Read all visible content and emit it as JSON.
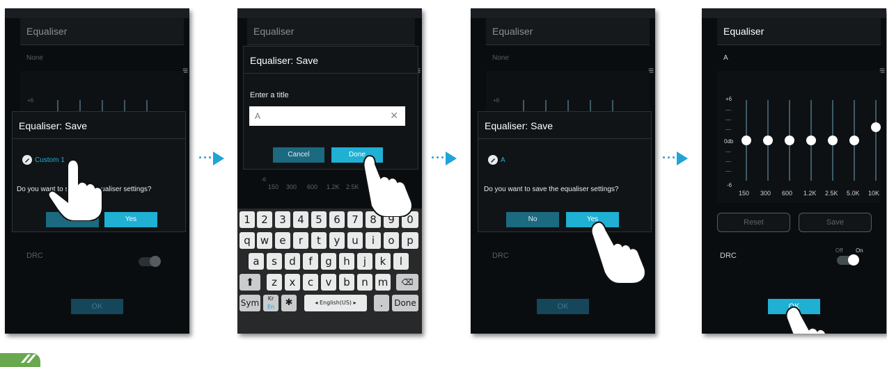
{
  "colors": {
    "accent": "#1fb0d4",
    "dark_button": "#1c6a80",
    "background": "#0a0d10",
    "arrow": "#1fa4d8"
  },
  "screen1": {
    "header_title": "Equaliser",
    "preset": "None",
    "db_top": "+6",
    "dialog": {
      "title": "Equaliser: Save",
      "preset_name": "Custom 1",
      "question": "Do you want to save the equaliser settings?",
      "no": "No",
      "yes": "Yes"
    },
    "drc": "DRC",
    "ok": "OK"
  },
  "screen2": {
    "header_title": "Equaliser",
    "dialog": {
      "title": "Equaliser: Save",
      "prompt": "Enter a title",
      "input_value": "A",
      "clear_icon": "close-icon",
      "cancel": "Cancel",
      "done": "Done"
    },
    "db_bottom": "-6",
    "freqs": [
      "150",
      "300",
      "600",
      "1.2K",
      "2.5K"
    ],
    "keyboard": {
      "row1": [
        "1",
        "2",
        "3",
        "4",
        "5",
        "6",
        "7",
        "8",
        "9",
        "0"
      ],
      "row2": [
        "q",
        "w",
        "e",
        "r",
        "t",
        "y",
        "u",
        "i",
        "o",
        "p"
      ],
      "row3": [
        "a",
        "s",
        "d",
        "f",
        "g",
        "h",
        "j",
        "k",
        "l"
      ],
      "row4": [
        "z",
        "x",
        "c",
        "v",
        "b",
        "n",
        "m"
      ],
      "sym": "Sym",
      "lang_top": "Kr",
      "lang_bottom": "En",
      "space_label": "English(US)",
      "period": ".",
      "done": "Done"
    }
  },
  "screen3": {
    "header_title": "Equaliser",
    "preset": "None",
    "db_top": "+6",
    "dialog": {
      "title": "Equaliser: Save",
      "preset_name": "A",
      "question": "Do you want to save the equaliser settings?",
      "no": "No",
      "yes": "Yes"
    },
    "drc": "DRC",
    "ok": "OK"
  },
  "screen4": {
    "header_title": "Equaliser",
    "preset": "A",
    "db_top": "+6",
    "db_mid": "0db",
    "db_bottom": "-6",
    "freqs": [
      "150",
      "300",
      "600",
      "1.2K",
      "2.5K",
      "5.0K",
      "10K"
    ],
    "band_levels_db": [
      0,
      0,
      0,
      0,
      0,
      0,
      2
    ],
    "reset": "Reset",
    "save": "Save",
    "drc": "DRC",
    "toggle_off": "Off",
    "toggle_on": "On",
    "ok": "OK"
  }
}
